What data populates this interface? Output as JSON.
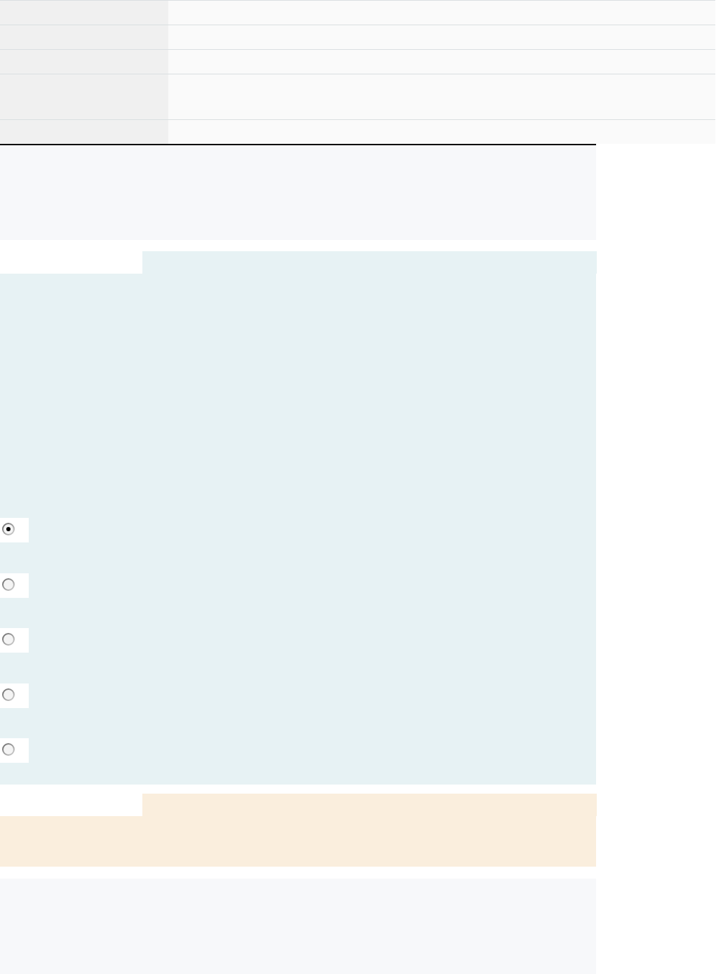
{
  "table": {
    "rows": [
      {
        "kind": "single"
      },
      {
        "kind": "single"
      },
      {
        "kind": "single"
      },
      {
        "kind": "double"
      },
      {
        "kind": "single"
      }
    ]
  },
  "question": {
    "options": [
      {
        "selected": true
      },
      {
        "selected": false
      },
      {
        "selected": false
      },
      {
        "selected": false
      },
      {
        "selected": false
      }
    ]
  }
}
